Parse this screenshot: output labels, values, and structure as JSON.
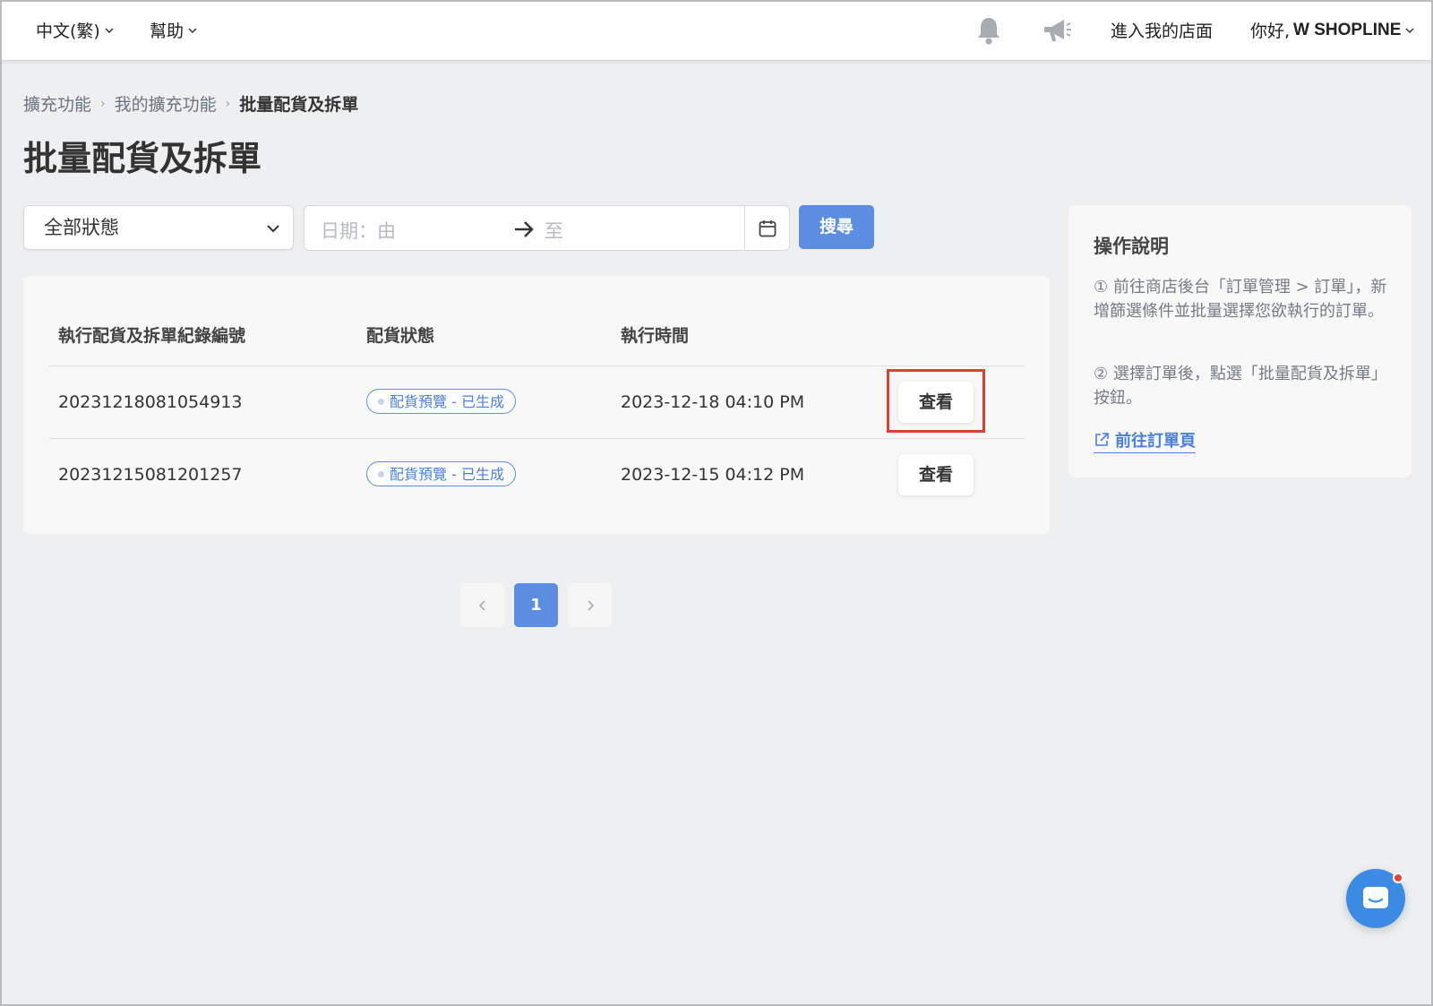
{
  "nav": {
    "language": "中文(繁)",
    "help": "幫助",
    "notifications_icon": "bell-icon",
    "announcements_icon": "megaphone-icon",
    "store_link": "進入我的店面",
    "greeting_prefix": "你好, ",
    "user_name": "W SHOPLINE"
  },
  "breadcrumb": {
    "items": [
      "擴充功能",
      "我的擴充功能",
      "批量配貨及拆單"
    ]
  },
  "page_title": "批量配貨及拆單",
  "filters": {
    "status_value": "全部狀態",
    "date_from_placeholder": "日期：由",
    "date_to_placeholder": "至",
    "search_label": "搜尋"
  },
  "table": {
    "columns": [
      "執行配貨及拆單紀錄編號",
      "配貨狀態",
      "執行時間"
    ],
    "rows": [
      {
        "id": "20231218081054913",
        "status": "配貨預覽 - 已生成",
        "time": "2023-12-18 04:10 PM",
        "action": "查看"
      },
      {
        "id": "20231215081201257",
        "status": "配貨預覽 - 已生成",
        "time": "2023-12-15 04:12 PM",
        "action": "查看"
      }
    ]
  },
  "pagination": {
    "current": "1"
  },
  "help": {
    "title": "操作說明",
    "step1": "① 前往商店後台「訂單管理 > 訂單」，新增篩選條件並批量選擇您欲執行的訂單。",
    "step2": "② 選擇訂單後，點選「批量配貨及拆單」按鈕。",
    "link": "前往訂單頁"
  },
  "colors": {
    "accent": "#5b8de3",
    "highlight": "#d9432e",
    "chat": "#3b8ae3"
  }
}
